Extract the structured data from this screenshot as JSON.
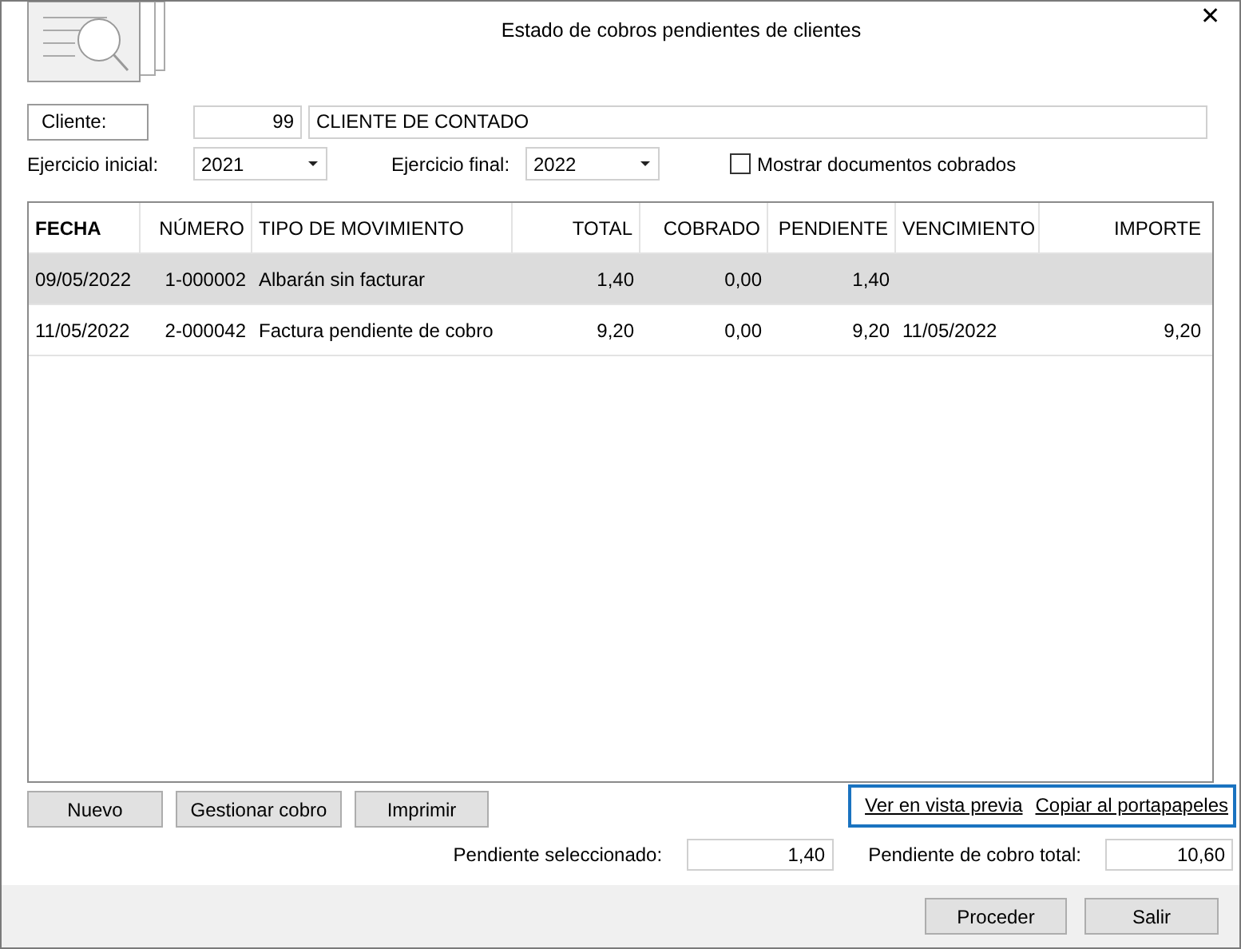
{
  "window": {
    "title": "Estado de cobros pendientes de clientes",
    "close": "✕"
  },
  "client": {
    "label": "Cliente:",
    "code": "99",
    "name": "CLIENTE DE CONTADO"
  },
  "filters": [
    {
      "label": "Ejercicio inicial:",
      "value": "2021"
    },
    {
      "label": "Ejercicio final:",
      "value": "2022"
    }
  ],
  "show_paid": {
    "label": "Mostrar documentos cobrados",
    "checked": false
  },
  "table": {
    "columns": [
      {
        "label": "FECHA",
        "bold": true
      },
      {
        "label": "NÚMERO",
        "bold": false
      },
      {
        "label": "TIPO DE MOVIMIENTO",
        "bold": false
      },
      {
        "label": "TOTAL",
        "bold": false
      },
      {
        "label": "COBRADO",
        "bold": false
      },
      {
        "label": "PENDIENTE",
        "bold": false
      },
      {
        "label": "VENCIMIENTO",
        "bold": false
      },
      {
        "label": "IMPORTE",
        "bold": false
      }
    ],
    "rows": [
      {
        "selected": true,
        "cells": [
          "09/05/2022",
          "1-000002",
          "Albarán sin facturar",
          "1,40",
          "0,00",
          "1,40",
          "",
          ""
        ]
      },
      {
        "selected": false,
        "cells": [
          "11/05/2022",
          "2-000042",
          "Factura pendiente de cobro",
          "9,20",
          "0,00",
          "9,20",
          "11/05/2022",
          "9,20"
        ]
      }
    ]
  },
  "actions": [
    "Nuevo",
    "Gestionar cobro",
    "Imprimir"
  ],
  "links": [
    "Ver en vista previa",
    "Copiar al portapapeles"
  ],
  "totals": [
    {
      "label": "Pendiente seleccionado:",
      "value": "1,40"
    },
    {
      "label": "Pendiente de cobro total:",
      "value": "10,60"
    }
  ],
  "footer_buttons": [
    "Proceder",
    "Salir"
  ]
}
